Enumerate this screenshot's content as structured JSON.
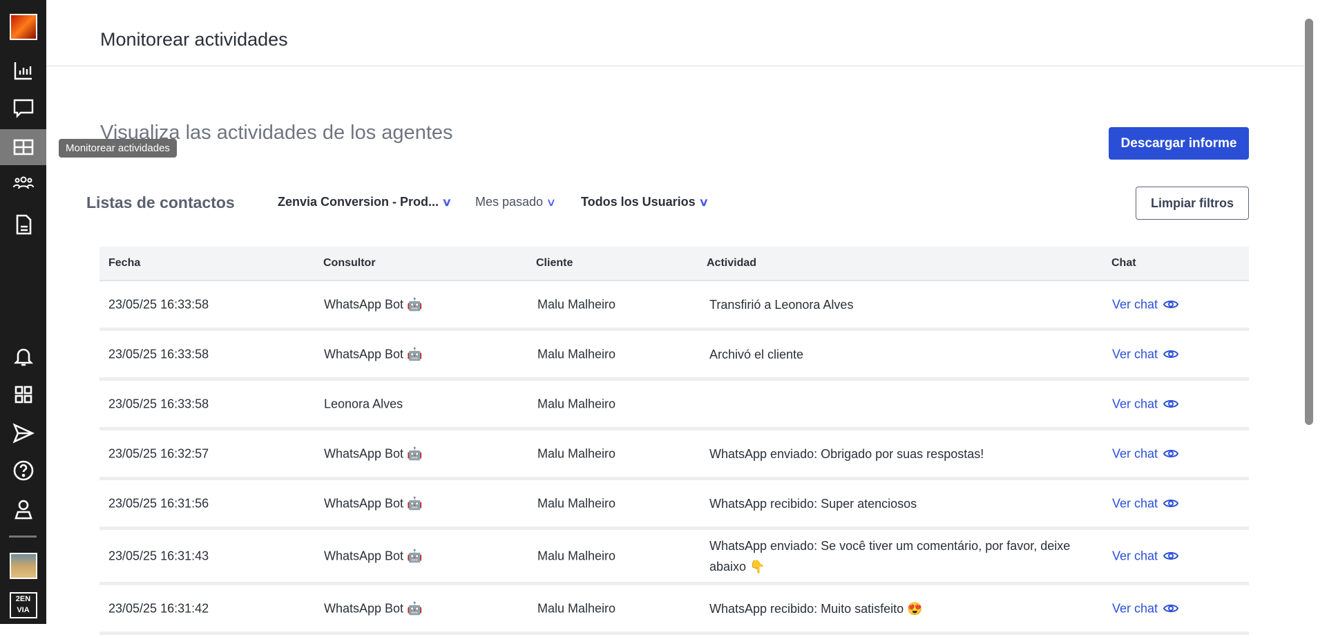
{
  "sidebar": {
    "tooltip": "Monitorear actividades",
    "items": [
      "logo",
      "analytics",
      "chat",
      "monitor",
      "contacts",
      "documents",
      "notifications",
      "apps",
      "send",
      "help",
      "profile",
      "avatar",
      "brand"
    ]
  },
  "header": {
    "title": "Monitorear actividades"
  },
  "main": {
    "subtitle": "Visualiza las actividades de los agentes",
    "download_button": "Descargar informe",
    "clear_button": "Limpiar filtros",
    "lists_label": "Listas de contactos",
    "filters": {
      "list": "Zenvia Conversion - Prod...",
      "period": "Mes pasado",
      "users": "Todos los Usuarios"
    }
  },
  "table": {
    "headers": [
      "Fecha",
      "Consultor",
      "Cliente",
      "Actividad",
      "Chat"
    ],
    "rows": [
      {
        "date": "23/05/25 16:33:58",
        "agent": "WhatsApp Bot 🤖",
        "client": "Malu Malheiro",
        "activity": "Transfirió a Leonora Alves",
        "chat": "Ver chat"
      },
      {
        "date": "23/05/25 16:33:58",
        "agent": "WhatsApp Bot 🤖",
        "client": "Malu Malheiro",
        "activity": "Archivó el cliente",
        "chat": "Ver chat"
      },
      {
        "date": "23/05/25 16:33:58",
        "agent": "Leonora Alves",
        "client": "Malu Malheiro",
        "activity": "",
        "chat": "Ver chat"
      },
      {
        "date": "23/05/25 16:32:57",
        "agent": "WhatsApp Bot 🤖",
        "client": "Malu Malheiro",
        "activity": "WhatsApp enviado: Obrigado por suas respostas!",
        "chat": "Ver chat"
      },
      {
        "date": "23/05/25 16:31:56",
        "agent": "WhatsApp Bot 🤖",
        "client": "Malu Malheiro",
        "activity": "WhatsApp recibido: Super atenciosos",
        "chat": "Ver chat"
      },
      {
        "date": "23/05/25 16:31:43",
        "agent": "WhatsApp Bot 🤖",
        "client": "Malu Malheiro",
        "activity": "WhatsApp enviado: Se você tiver um comentário, por favor, deixe abaixo 👇",
        "chat": "Ver chat"
      },
      {
        "date": "23/05/25 16:31:42",
        "agent": "WhatsApp Bot 🤖",
        "client": "Malu Malheiro",
        "activity": "WhatsApp recibido: Muito satisfeito 😍",
        "chat": "Ver chat"
      }
    ]
  }
}
